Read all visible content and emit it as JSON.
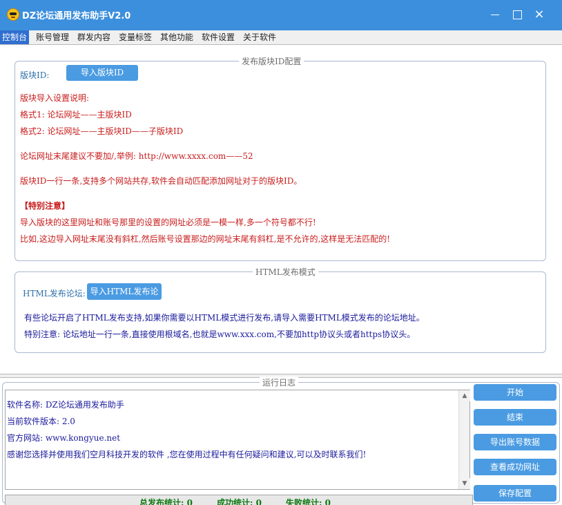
{
  "window": {
    "title": "DZ论坛通用发布助手V2.0",
    "icon": "sunglasses-emoji-icon",
    "controls": {
      "minimize": "minimize-icon",
      "maximize": "maximize-icon",
      "close": "×"
    }
  },
  "tabs": [
    "控制台",
    "账号管理",
    "群发内容",
    "变量标签",
    "其他功能",
    "软件设置",
    "关于软件"
  ],
  "section_forum_id": {
    "title": "发布版块ID配置",
    "label": "版块ID:",
    "import_button": "导入版块ID",
    "lines": [
      "版块导入设置说明:",
      "格式1: 论坛网址——主版块ID",
      "格式2: 论坛网址——主版块ID——子版块ID",
      "论坛网址末尾建议不要加/,举例: http://www.xxxx.com——52",
      "版块ID一行一条,支持多个网站共存,软件会自动匹配添加网址对于的版块ID。",
      "【特别注意】",
      "导入版块的这里网址和账号那里的设置的网址必须是一模一样,多一个符号都不行!",
      "比如,这边导入网址末尾没有斜杠,然后账号设置那边的网址末尾有斜杠,是不允许的,这样是无法匹配的!"
    ]
  },
  "section_html": {
    "title": "HTML发布模式",
    "label": "HTML发布论坛:",
    "import_button": "导入HTML发布论坛",
    "lines": [
      "有些论坛开启了HTML发布支持,如果你需要以HTML模式进行发布,请导入需要HTML模式发布的论坛地址。",
      "特别注意: 论坛地址一行一条,直接使用根域名,也就是www.xxx.com,不要加http协议头或者https协议头。"
    ]
  },
  "log": {
    "title": "运行日志",
    "lines": [
      "软件名称: DZ论坛通用发布助手",
      "当前软件版本: 2.0",
      "官方网站: www.kongyue.net",
      "感谢您选择并使用我们空月科技开发的软件 ,您在使用过程中有任何疑问和建议,可以及时联系我们!"
    ]
  },
  "stats": {
    "total": "总发布统计: 0",
    "success": "成功统计: 0",
    "fail": "失败统计: 0"
  },
  "actions": [
    "开始",
    "结束",
    "导出账号数据",
    "查看成功网址",
    "保存配置"
  ],
  "colors": {
    "titlebar": "#3c8fdc",
    "accent_button": "#4a9be2",
    "tab_active": "#2f6fd0",
    "instruction_red": "#c81c1c",
    "log_navy": "#1a1a9c",
    "stats_green": "#0f7a12"
  }
}
